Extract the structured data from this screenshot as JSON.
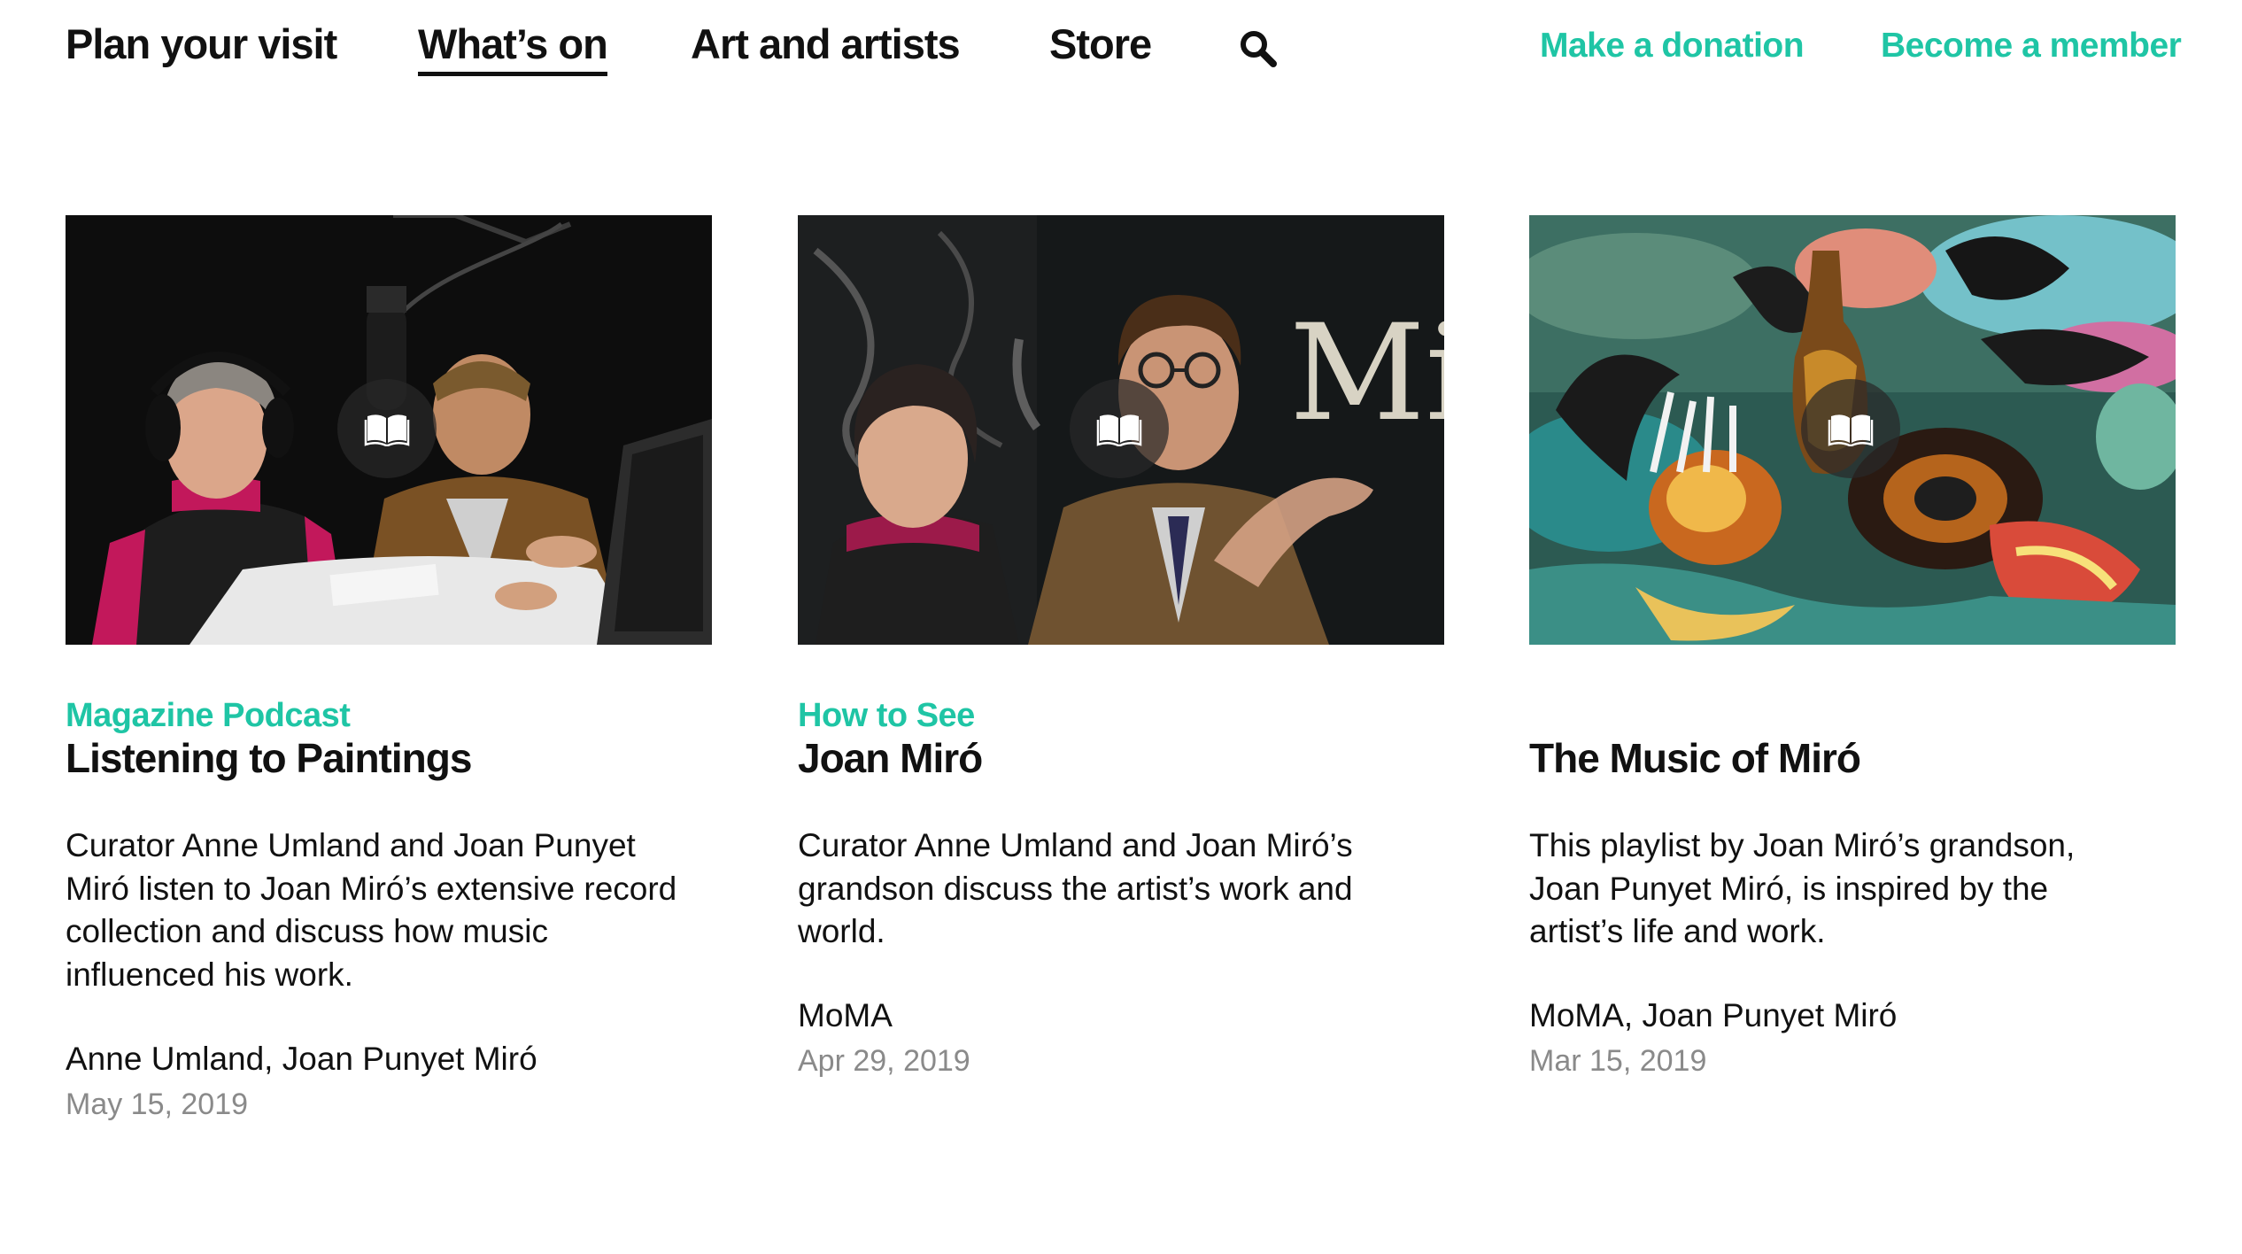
{
  "nav": {
    "items": [
      {
        "label": "Plan your visit"
      },
      {
        "label": "What’s on",
        "active": true
      },
      {
        "label": "Art and artists"
      },
      {
        "label": "Store"
      }
    ],
    "search_icon": "search-icon",
    "donate_label": "Make a donation",
    "member_label": "Become a member"
  },
  "colors": {
    "accent": "#1fc5a5",
    "text": "#111111",
    "muted": "#8a8a8a"
  },
  "cards": [
    {
      "eyebrow": "Magazine Podcast",
      "title": "Listening to Paintings",
      "description": "Curator Anne Umland and Joan Punyet Miró listen to Joan Miró’s extensive record collection and discuss how music influenced his work.",
      "credit": "Anne Umland, Joan Punyet Miró",
      "date": "May 15, 2019",
      "icon": "book-icon"
    },
    {
      "eyebrow": "How to See",
      "title": "Joan Miró",
      "description": "Curator Anne Umland and Joan Miró’s grandson discuss the artist’s work and world.",
      "credit": "MoMA",
      "date": "Apr 29, 2019",
      "icon": "book-icon",
      "image_text": "Miró"
    },
    {
      "eyebrow": "",
      "title": "The Music of Miró",
      "description": "This playlist by Joan Miró’s grandson, Joan Punyet Miró, is inspired by the artist’s life and work.",
      "credit": "MoMA, Joan Punyet Miró",
      "date": "Mar 15, 2019",
      "icon": "book-icon"
    }
  ]
}
